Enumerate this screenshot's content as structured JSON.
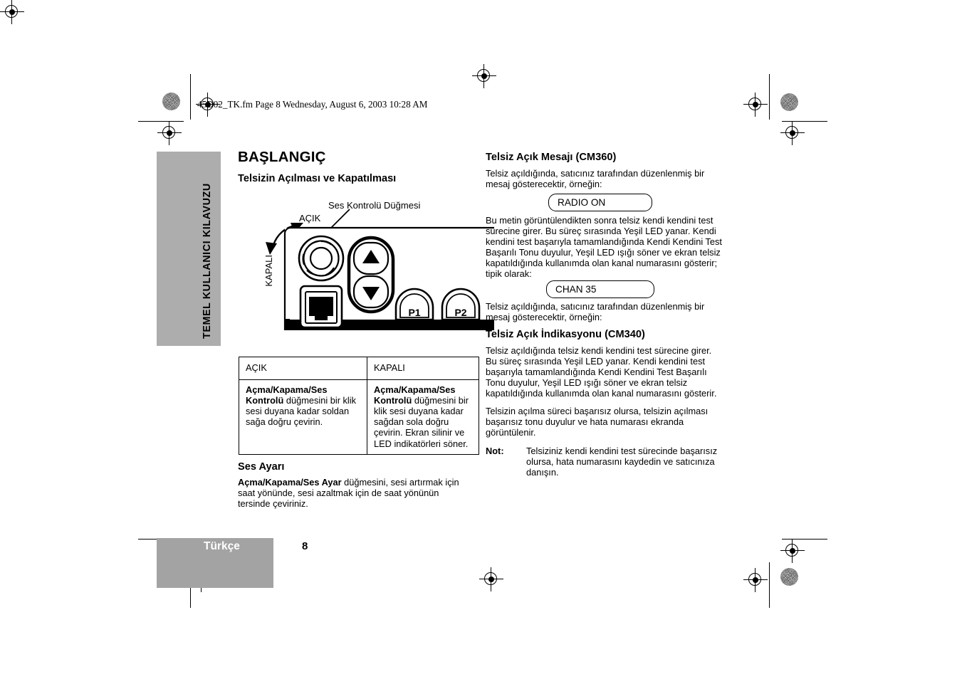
{
  "document": {
    "running_header": "45D02_TK.fm  Page 8  Wednesday, August 6, 2003  10:28 AM",
    "page_number": "8",
    "language_tab": "Türkçe",
    "side_tab": "TEMEL KULLANICI KILAVUZU"
  },
  "left_column": {
    "chapter_title": "BAŞLANGIÇ",
    "section_heading": "Telsizin Açılması ve Kapatılması",
    "diagram": {
      "callout_volume": "Ses Kontrolü Düğmesi",
      "label_on": "AÇIK",
      "label_off": "KAPALI",
      "button_p1": "P1",
      "button_p2": "P2"
    },
    "table": {
      "headers": [
        "AÇIK",
        "KAPALI"
      ],
      "row": [
        {
          "bold": "Açma/Kapama/Ses Kontrolü",
          "rest": " düğmesini bir klik sesi duyana kadar soldan sağa doğru çevirin."
        },
        {
          "bold": "Açma/Kapama/Ses Kontrolü",
          "rest": " düğmesini bir klik sesi duyana kadar sağdan sola doğru çevirin. Ekran silinir ve LED indikatörleri söner."
        }
      ]
    },
    "volume_heading": "Ses Ayarı",
    "volume_bold": "Açma/Kapama/Ses Ayar",
    "volume_text": " düğmesini, sesi artırmak için saat yönünde, sesi azaltmak için de saat yönünün tersinde çeviriniz."
  },
  "right_column": {
    "heading_cm360": "Telsiz Açık Mesajı (CM360)",
    "para1": "Telsiz açıldığında, satıcınız tarafından düzenlenmiş bir mesaj gösterecektir, örneğin:",
    "lcd_radio_on": "RADIO ON",
    "para2": "Bu metin görüntülendikten sonra telsiz kendi kendini test sürecine girer. Bu süreç sırasında Yeşil LED yanar. Kendi kendini test başarıyla tamamlandığında Kendi Kendini Test Başarılı Tonu duyulur, Yeşil LED ışığı söner ve ekran telsiz kapatıldığında kullanımda olan kanal numarasını gösterir; tipik olarak:",
    "lcd_chan": "CHAN   35",
    "para3": "Telsiz açıldığında, satıcınız tarafından düzenlenmiş bir mesaj gösterecektir, örneğin:",
    "heading_cm340": "Telsiz Açık İndikasyonu (CM340)",
    "para4": "Telsiz açıldığında telsiz kendi kendini test sürecine girer. Bu süreç sırasında Yeşil LED yanar. Kendi kendini test başarıyla tamamlandığında Kendi Kendini Test Başarılı Tonu duyulur, Yeşil LED ışığı söner ve ekran telsiz kapatıldığında kullanımda olan kanal numarasını gösterir.",
    "para5": "Telsizin açılma süreci başarısız olursa, telsizin açılması başarısız tonu duyulur ve hata numarası ekranda görüntülenir.",
    "note_label": "Not:",
    "note_text": "Telsiziniz kendi kendini test sürecinde başarısız olursa, hata numarasını kaydedin ve satıcınıza danışın."
  },
  "colors": {
    "sidebar_gray": "#adadad",
    "footer_gray": "#a3a3a3",
    "text": "#000000"
  }
}
